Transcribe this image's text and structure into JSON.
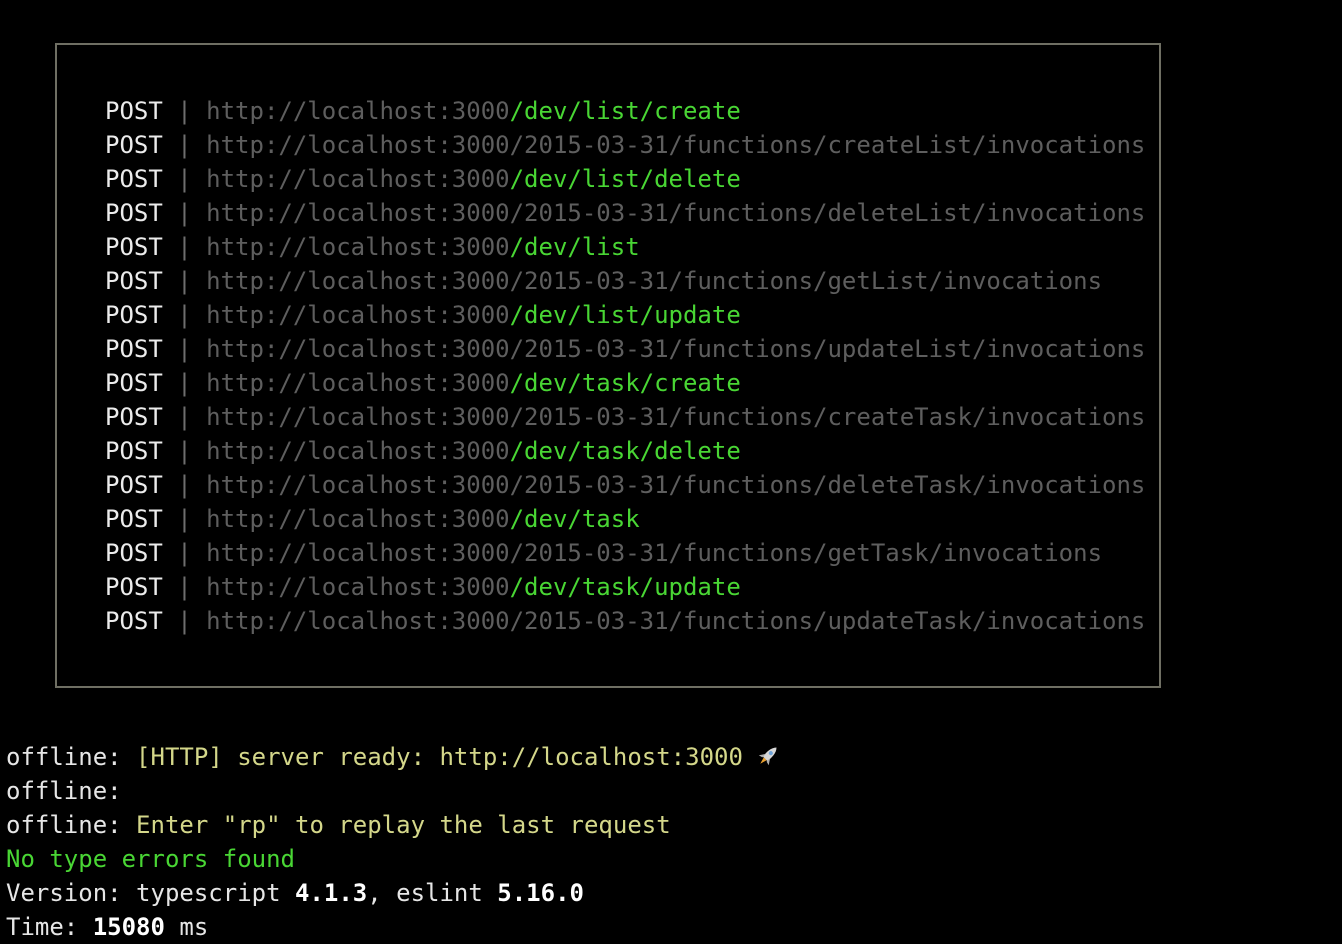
{
  "routes": [
    {
      "method": "POST",
      "sep": "|",
      "base": "http://localhost:3000",
      "path": "/dev/list/create",
      "highlight": true
    },
    {
      "method": "POST",
      "sep": "|",
      "base": "http://localhost:3000",
      "path": "/2015-03-31/functions/createList/invocations",
      "highlight": false
    },
    {
      "method": "POST",
      "sep": "|",
      "base": "http://localhost:3000",
      "path": "/dev/list/delete",
      "highlight": true
    },
    {
      "method": "POST",
      "sep": "|",
      "base": "http://localhost:3000",
      "path": "/2015-03-31/functions/deleteList/invocations",
      "highlight": false
    },
    {
      "method": "POST",
      "sep": "|",
      "base": "http://localhost:3000",
      "path": "/dev/list",
      "highlight": true
    },
    {
      "method": "POST",
      "sep": "|",
      "base": "http://localhost:3000",
      "path": "/2015-03-31/functions/getList/invocations",
      "highlight": false
    },
    {
      "method": "POST",
      "sep": "|",
      "base": "http://localhost:3000",
      "path": "/dev/list/update",
      "highlight": true
    },
    {
      "method": "POST",
      "sep": "|",
      "base": "http://localhost:3000",
      "path": "/2015-03-31/functions/updateList/invocations",
      "highlight": false
    },
    {
      "method": "POST",
      "sep": "|",
      "base": "http://localhost:3000",
      "path": "/dev/task/create",
      "highlight": true
    },
    {
      "method": "POST",
      "sep": "|",
      "base": "http://localhost:3000",
      "path": "/2015-03-31/functions/createTask/invocations",
      "highlight": false
    },
    {
      "method": "POST",
      "sep": "|",
      "base": "http://localhost:3000",
      "path": "/dev/task/delete",
      "highlight": true
    },
    {
      "method": "POST",
      "sep": "|",
      "base": "http://localhost:3000",
      "path": "/2015-03-31/functions/deleteTask/invocations",
      "highlight": false
    },
    {
      "method": "POST",
      "sep": "|",
      "base": "http://localhost:3000",
      "path": "/dev/task",
      "highlight": true
    },
    {
      "method": "POST",
      "sep": "|",
      "base": "http://localhost:3000",
      "path": "/2015-03-31/functions/getTask/invocations",
      "highlight": false
    },
    {
      "method": "POST",
      "sep": "|",
      "base": "http://localhost:3000",
      "path": "/dev/task/update",
      "highlight": true
    },
    {
      "method": "POST",
      "sep": "|",
      "base": "http://localhost:3000",
      "path": "/2015-03-31/functions/updateTask/invocations",
      "highlight": false
    }
  ],
  "log": {
    "line1": {
      "prefix": "offline: ",
      "message": "[HTTP] server ready: http://localhost:3000",
      "icon": "rocket-icon"
    },
    "line2": {
      "prefix": "offline: "
    },
    "line3": {
      "prefix": "offline: ",
      "message": "Enter \"rp\" to replay the last request"
    },
    "line4": {
      "message": "No type errors found"
    },
    "line5": {
      "label": "Version: typescript ",
      "ts_version": "4.1.3",
      "middle": ", eslint ",
      "eslint_version": "5.16.0"
    },
    "line6": {
      "label": "Time: ",
      "time_value": "15080",
      "unit": " ms"
    }
  },
  "colors": {
    "background": "#000000",
    "border": "#6f6f63",
    "route_highlight": "#49d634",
    "route_dim": "#5e5e5e",
    "log_yellow": "#d4d78a",
    "log_green": "#49d634"
  }
}
